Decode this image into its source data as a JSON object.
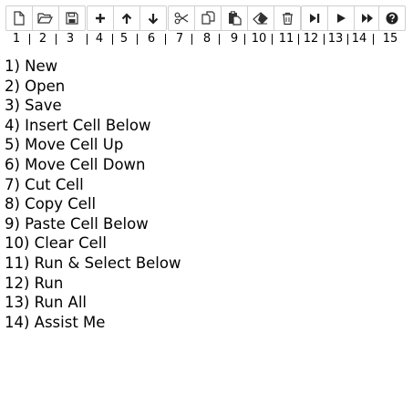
{
  "toolbar": {
    "icons": [
      {
        "id": 1,
        "icon": "file-icon"
      },
      {
        "id": 2,
        "icon": "folder-open-icon"
      },
      {
        "id": 3,
        "icon": "save-icon"
      },
      {
        "id": 4,
        "icon": "plus-icon"
      },
      {
        "id": 5,
        "icon": "arrow-up-icon"
      },
      {
        "id": 6,
        "icon": "arrow-down-icon"
      },
      {
        "id": 7,
        "icon": "scissors-icon"
      },
      {
        "id": 8,
        "icon": "copy-icon"
      },
      {
        "id": 9,
        "icon": "paste-icon"
      },
      {
        "id": 10,
        "icon": "eraser-icon"
      },
      {
        "id": 11,
        "icon": "trash-icon"
      },
      {
        "id": 12,
        "icon": "step-forward-icon"
      },
      {
        "id": 13,
        "icon": "play-icon"
      },
      {
        "id": 14,
        "icon": "fast-forward-icon"
      },
      {
        "id": 15,
        "icon": "question-circle-icon"
      }
    ]
  },
  "numbers": [
    "1",
    "2",
    "3",
    "4",
    "5",
    "6",
    "7",
    "8",
    "9",
    "10",
    "11",
    "12",
    "13",
    "14",
    "15"
  ],
  "legend": [
    "1) New",
    "2) Open",
    "3) Save",
    "4) Insert Cell Below",
    "5) Move Cell Up",
    "6) Move Cell Down",
    "7) Cut Cell",
    "8) Copy Cell",
    "9) Paste Cell Below",
    "10) Clear Cell",
    "11) Run & Select Below",
    "12) Run",
    "13) Run All",
    "14) Assist Me"
  ]
}
